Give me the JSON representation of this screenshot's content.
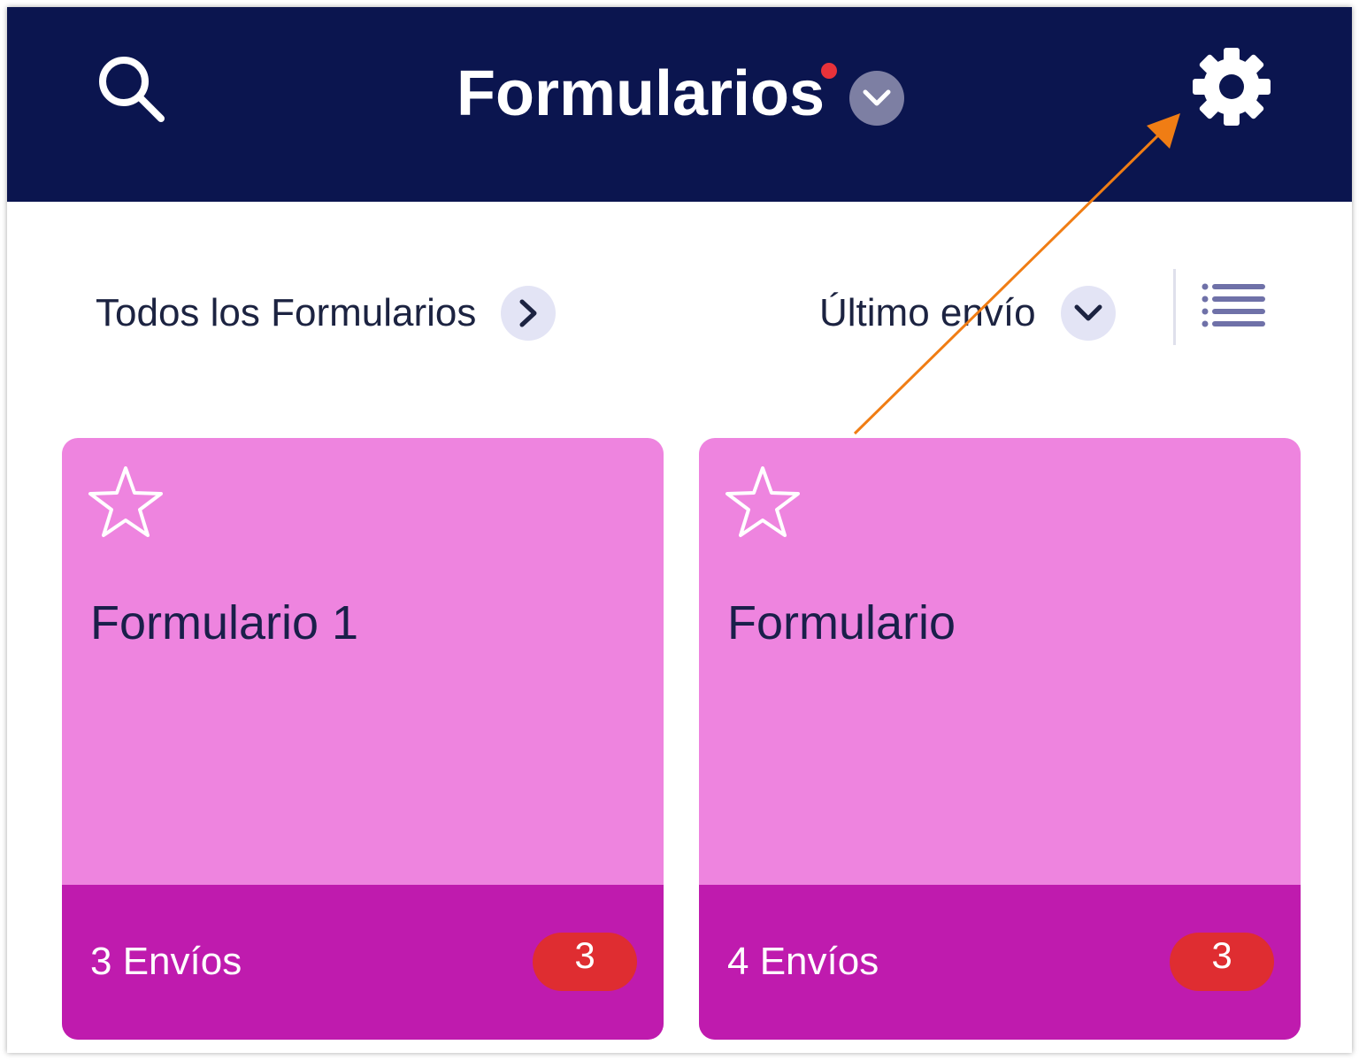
{
  "header": {
    "title": "Formularios",
    "search_icon": "search-icon",
    "settings_icon": "gear-icon",
    "dropdown_icon": "chevron-down-icon",
    "notification_color": "#e8323a",
    "background": "#0b154f"
  },
  "filters": {
    "category_label": "Todos los Formularios",
    "category_icon": "chevron-right-icon",
    "sort_label": "Último envío",
    "sort_icon": "chevron-down-icon",
    "view_icon": "list-view-icon"
  },
  "cards": [
    {
      "title": "Formulario 1",
      "submissions": "3 Envíos",
      "badge": "3",
      "favorite_icon": "star-outline-icon"
    },
    {
      "title": "Formulario",
      "submissions": "4 Envíos",
      "badge": "3",
      "favorite_icon": "star-outline-icon"
    }
  ],
  "colors": {
    "card_body": "#ee84df",
    "card_footer": "#bf1bae",
    "badge": "#df2d31",
    "annotation_arrow": "#f07d14"
  }
}
